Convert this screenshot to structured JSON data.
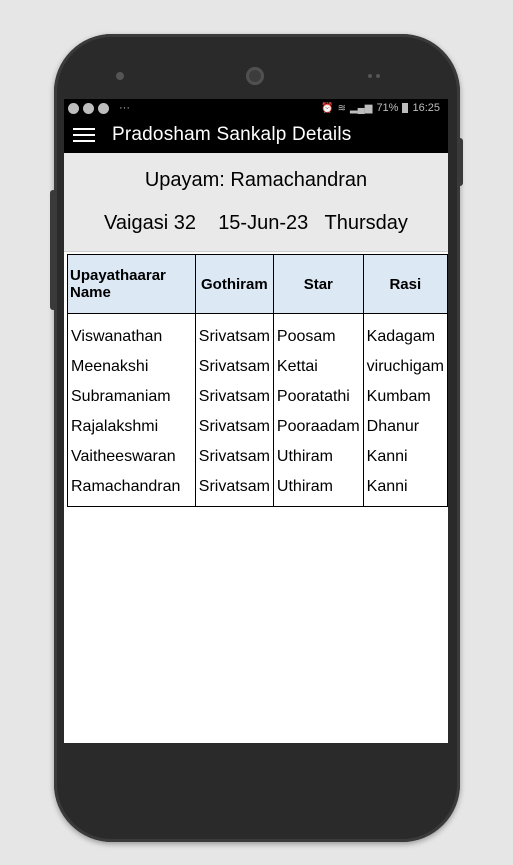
{
  "status_bar": {
    "left_icons": [
      "notification-icon",
      "notification-icon",
      "notification-icon"
    ],
    "left_more": "···",
    "right_text": "71%",
    "time": "16:25"
  },
  "app": {
    "title": "Pradosham Sankalp Details"
  },
  "header": {
    "upayam": "Upayam: Ramachandran",
    "date_line": "Vaigasi 32    15-Jun-23   Thursday"
  },
  "table": {
    "headers": [
      "Upayathaarar Name",
      "Gothiram",
      "Star",
      "Rasi"
    ],
    "rows": [
      [
        "Viswanathan",
        "Srivatsam",
        "Poosam",
        "Kadagam"
      ],
      [
        "Meenakshi",
        "Srivatsam",
        "Kettai",
        "viruchigam"
      ],
      [
        "Subramaniam",
        "Srivatsam",
        "Pooratathi",
        "Kumbam"
      ],
      [
        "Rajalakshmi",
        "Srivatsam",
        "Pooraadam",
        "Dhanur"
      ],
      [
        "Vaitheeswaran",
        "Srivatsam",
        "Uthiram",
        "Kanni"
      ],
      [
        "Ramachandran",
        "Srivatsam",
        "Uthiram",
        "Kanni"
      ]
    ]
  }
}
